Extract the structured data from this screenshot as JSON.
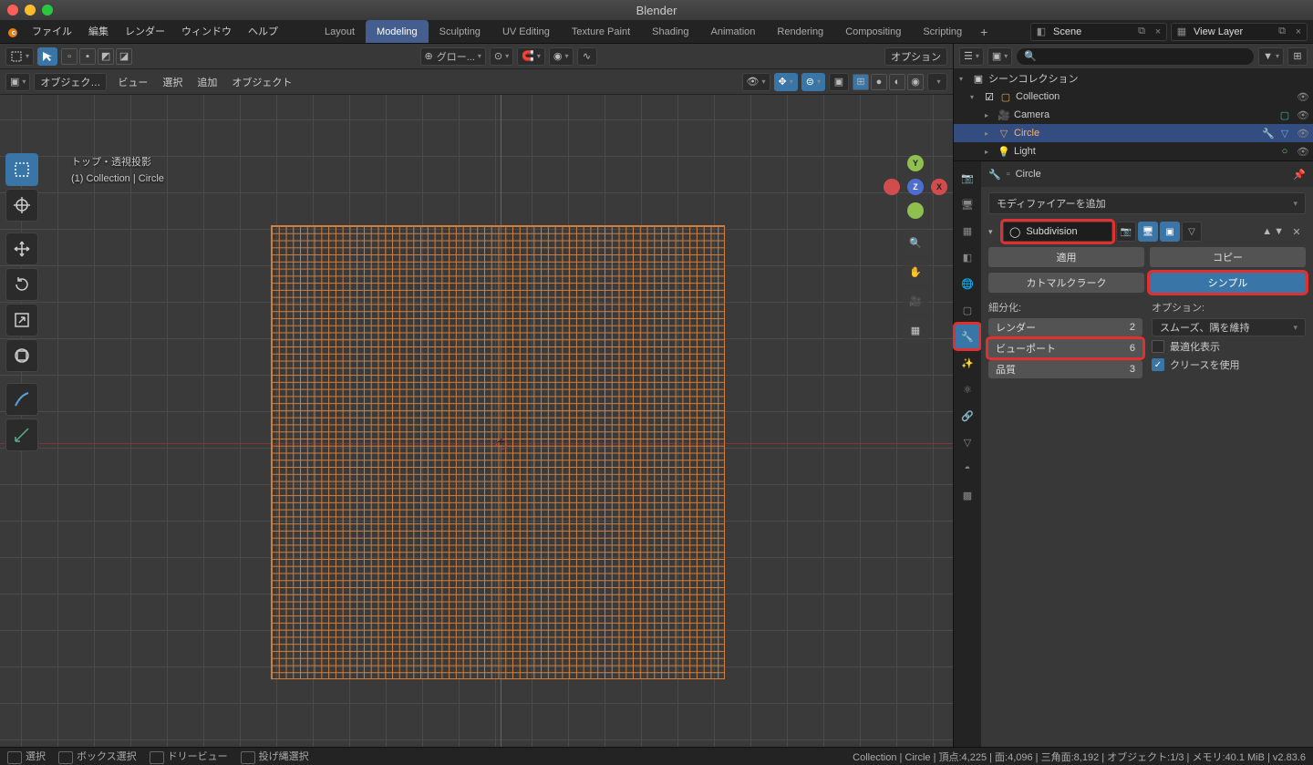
{
  "window": {
    "title": "Blender"
  },
  "menu": [
    "ファイル",
    "編集",
    "レンダー",
    "ウィンドウ",
    "ヘルプ"
  ],
  "workspaces": {
    "tabs": [
      "Layout",
      "Modeling",
      "Sculpting",
      "UV Editing",
      "Texture Paint",
      "Shading",
      "Animation",
      "Rendering",
      "Compositing",
      "Scripting"
    ],
    "active": "Modeling",
    "add": "+"
  },
  "scene": {
    "label": "Scene"
  },
  "view_layer": {
    "label": "View Layer"
  },
  "header1": {
    "transform_orient": "グロー...",
    "options": "オプション"
  },
  "header2": {
    "mode": "オブジェク…",
    "items": [
      "ビュー",
      "選択",
      "追加",
      "オブジェクト"
    ]
  },
  "viewport_overlay": {
    "line1": "トップ・透視投影",
    "line2": "(1) Collection | Circle"
  },
  "outliner": {
    "root": "シーンコレクション",
    "collection": "Collection",
    "items": [
      {
        "name": "Camera",
        "icon": "camera-icon",
        "sel": false
      },
      {
        "name": "Circle",
        "icon": "mesh-icon",
        "sel": true
      },
      {
        "name": "Light",
        "icon": "light-icon",
        "sel": false
      }
    ]
  },
  "properties": {
    "crumb_object": "Circle",
    "add_modifier": "モディファイアーを追加",
    "modifier": {
      "name": "Subdivision",
      "apply": "適用",
      "copy": "コピー",
      "type_catmull": "カトマルクラーク",
      "type_simple": "シンプル",
      "subdiv_label": "細分化:",
      "options_label": "オプション:",
      "render_label": "レンダー",
      "render_val": "2",
      "viewport_label": "ビューポート",
      "viewport_val": "6",
      "quality_label": "品質",
      "quality_val": "3",
      "uv_smooth": "スムーズ、隅を維持",
      "optimal": "最適化表示",
      "creases": "クリースを使用"
    }
  },
  "status": {
    "select": "選択",
    "box": "ボックス選択",
    "dolly": "ドリービュー",
    "lasso": "投げ縄選択",
    "right": "Collection | Circle | 頂点:4,225 | 面:4,096 | 三角面:8,192 | オブジェクト:1/3 | メモリ:40.1 MiB | v2.83.6"
  }
}
